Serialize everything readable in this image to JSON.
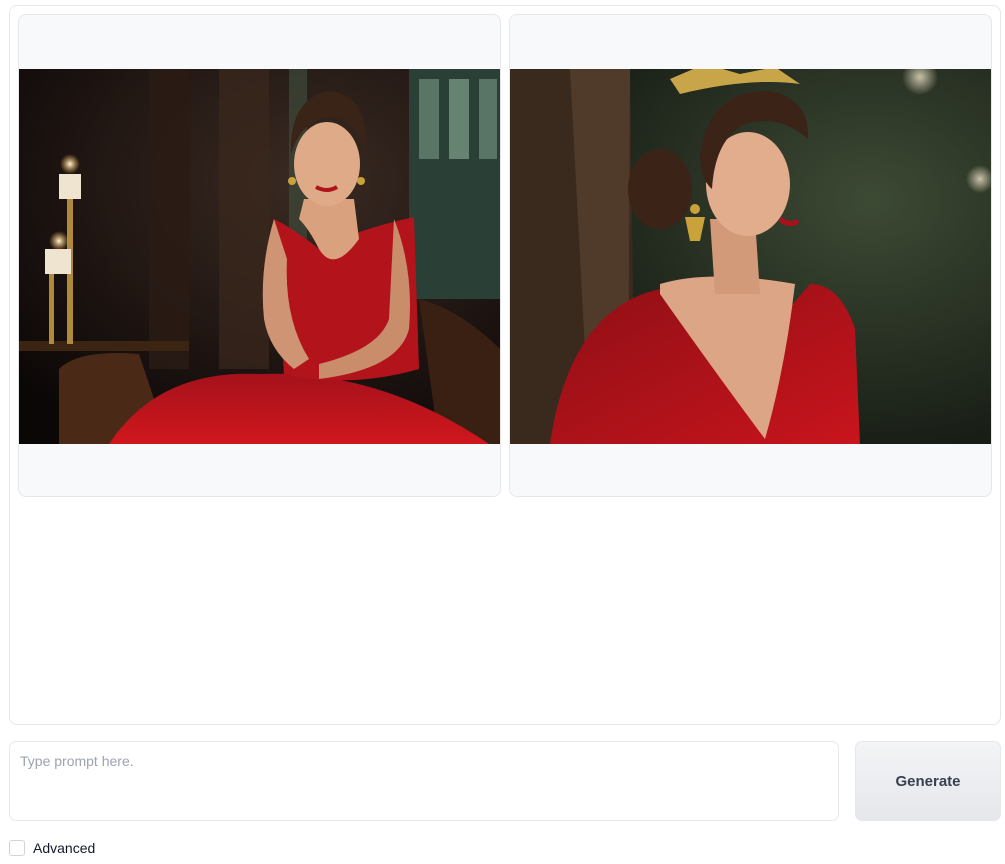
{
  "gallery": {
    "images": [
      {
        "name": "woman in red gown seated by candles"
      },
      {
        "name": "woman in red gown with tiara, profile"
      }
    ]
  },
  "prompt": {
    "placeholder": "Type prompt here.",
    "value": ""
  },
  "generate_button": {
    "label": "Generate"
  },
  "advanced": {
    "label": "Advanced",
    "checked": false
  },
  "colors": {
    "gown": "#b4141c",
    "background_dark": "#1a0d0b"
  }
}
